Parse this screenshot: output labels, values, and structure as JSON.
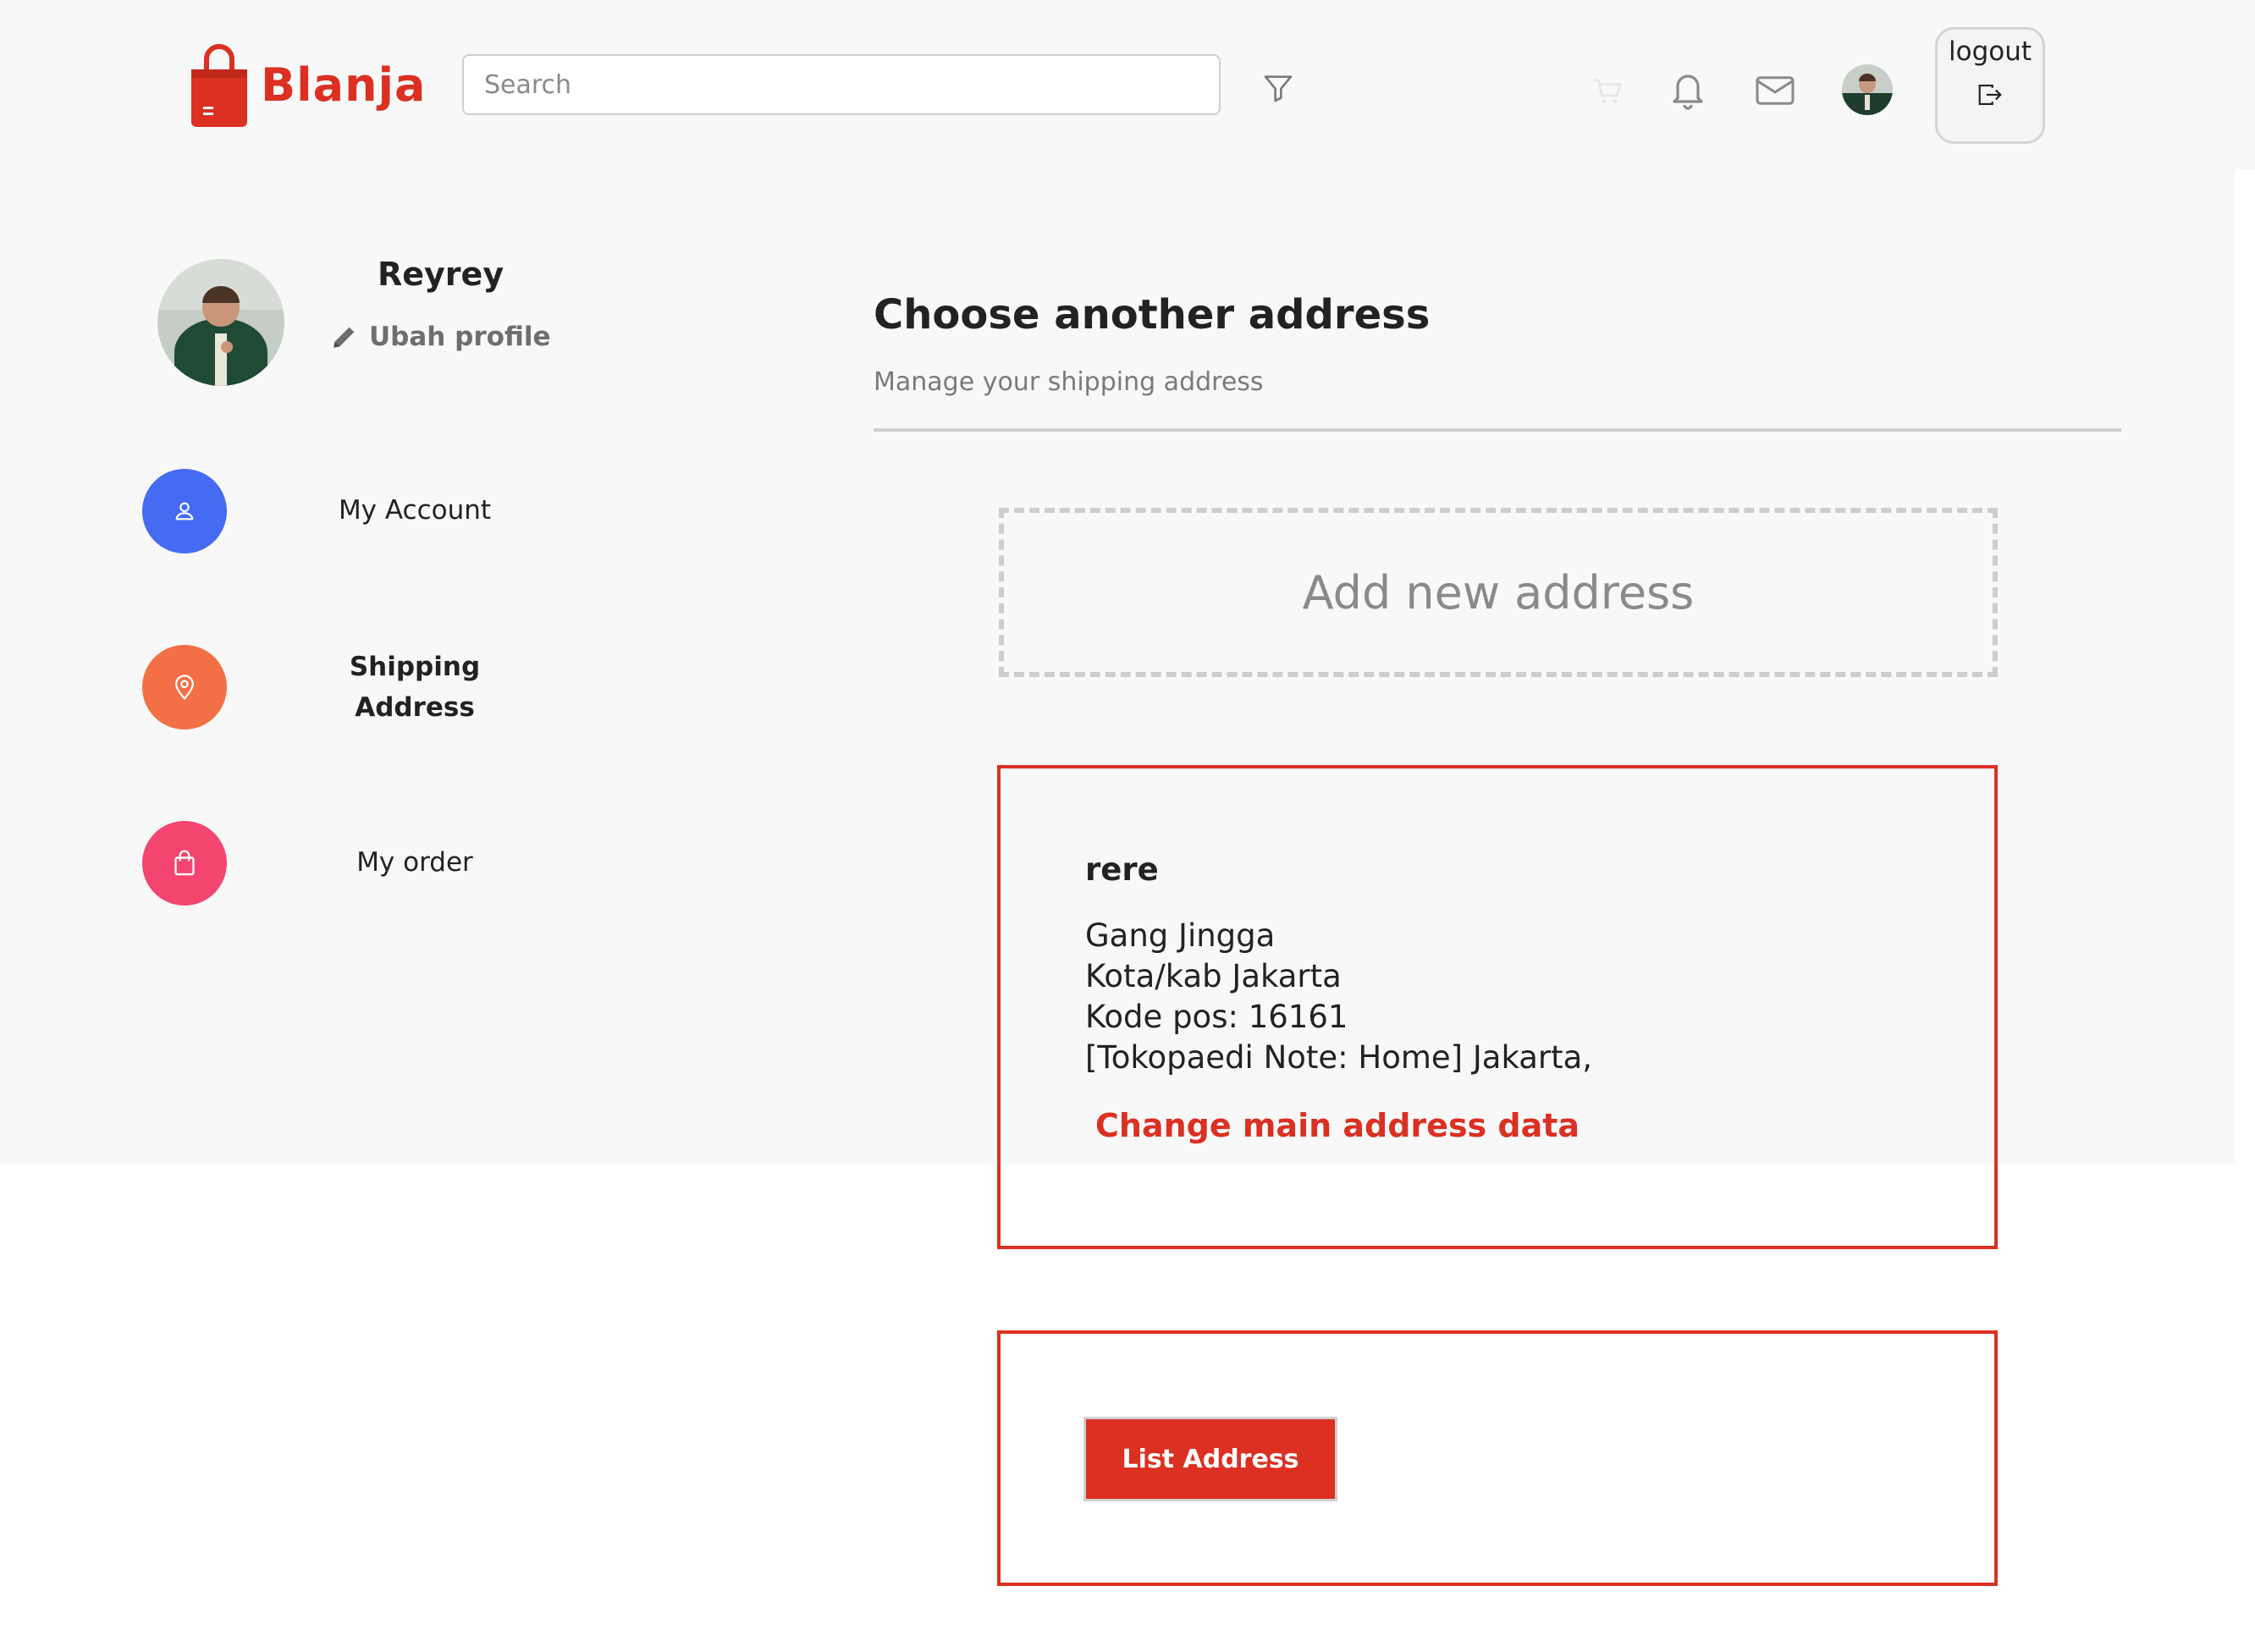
{
  "brand": {
    "name": "Blanja",
    "color": "#db3022"
  },
  "header": {
    "search_placeholder": "Search",
    "icons": [
      "filter-icon",
      "cart-icon",
      "bell-icon",
      "mail-icon"
    ],
    "logout_label": "logout"
  },
  "profile": {
    "name": "Reyrey",
    "edit_label": "Ubah profile"
  },
  "sidebar": {
    "items": [
      {
        "label": "My Account",
        "icon": "user-icon",
        "color": "#456bf3"
      },
      {
        "label": "Shipping Address",
        "icon": "map-pin-icon",
        "color": "#f36f45"
      },
      {
        "label": "My order",
        "icon": "shopping-bag-icon",
        "color": "#f3456f"
      }
    ]
  },
  "main": {
    "title": "Choose another address",
    "subtitle": "Manage your shipping address",
    "add_label": "Add new address",
    "address": {
      "name": "rere",
      "lines": [
        "Gang Jingga",
        "Kota/kab Jakarta",
        "Kode pos: 16161",
        "[Tokopaedi Note: Home] Jakarta,"
      ],
      "change_label": "Change main address data"
    },
    "list_button": "List Address"
  }
}
